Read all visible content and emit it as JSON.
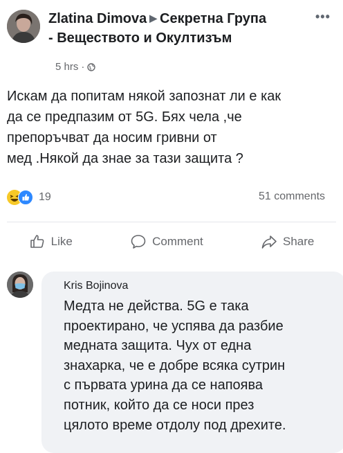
{
  "post": {
    "author": "Zlatina Dimova",
    "group_line1": "Секретна Група",
    "group_line2": "- Веществото и Окултизъм",
    "time": "5 hrs",
    "text": "Искам да попитам някой запознат ли е как\nда се предпазим от 5G. Бях чела ,че\nпрепоръчват да носим гривни от\nмед .Някой да знае за тази защита ?",
    "reaction_count": "19",
    "comments_count": "51 comments"
  },
  "actions": {
    "like": "Like",
    "comment": "Comment",
    "share": "Share"
  },
  "comment": {
    "author": "Kris Bojinova",
    "text": "Медта не действа. 5G е така\nпроектирано, че успява да разбие\nмедната защита. Чух от една\nзнахарка, че е добре всяка сутрин\nс първата урина да се напоява\nпотник, който да се носи през\nцялото време отдолу под дрехите."
  },
  "colors": {
    "text": "#1c1e21",
    "secondary": "#65676b",
    "bubble": "#f0f2f5",
    "like_blue": "#2d88ff",
    "haha_yellow": "#f7c928"
  },
  "icons": {
    "more": "more-horizontal-icon",
    "globe": "globe-icon",
    "like": "thumbs-up-icon",
    "comment": "comment-bubble-icon",
    "share": "share-arrow-icon"
  }
}
